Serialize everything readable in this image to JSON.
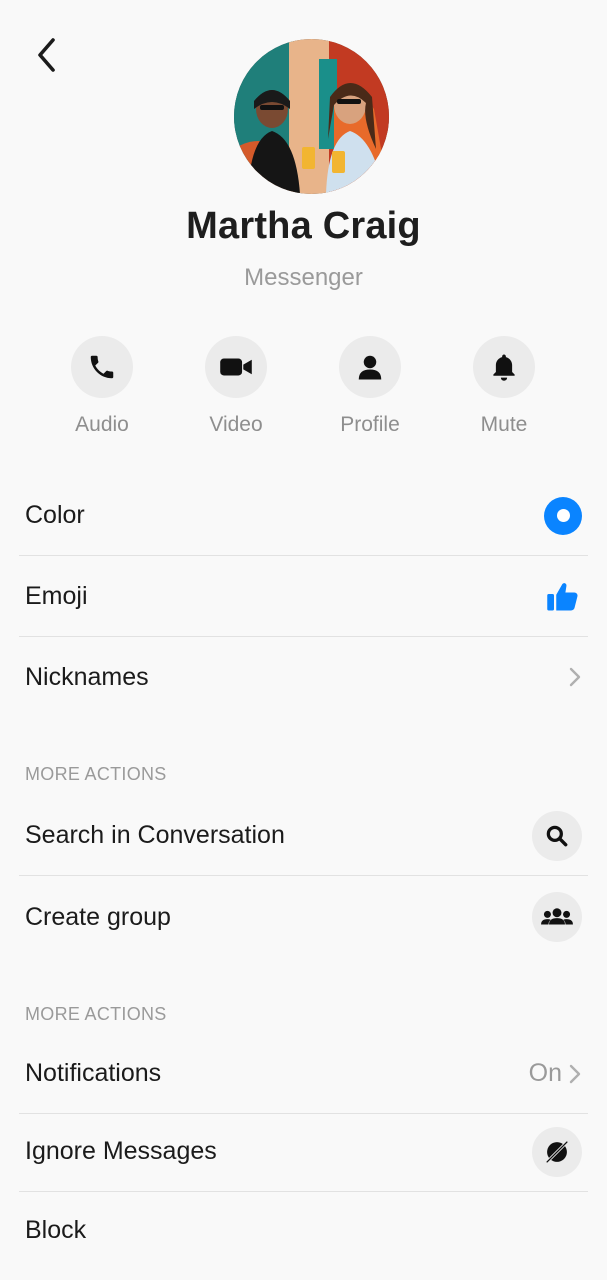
{
  "contact": {
    "name": "Martha Craig",
    "subtitle": "Messenger"
  },
  "quick_actions": [
    {
      "label": "Audio",
      "icon": "phone-icon"
    },
    {
      "label": "Video",
      "icon": "video-camera-icon"
    },
    {
      "label": "Profile",
      "icon": "person-icon"
    },
    {
      "label": "Mute",
      "icon": "bell-icon"
    }
  ],
  "customize": {
    "color_label": "Color",
    "emoji_label": "Emoji",
    "nicknames_label": "Nicknames"
  },
  "section_1": {
    "header": "MORE ACTIONS",
    "search_label": "Search in Conversation",
    "create_group_label": "Create group"
  },
  "section_2": {
    "header": "MORE ACTIONS",
    "notifications_label": "Notifications",
    "notifications_value": "On",
    "ignore_label": "Ignore Messages",
    "block_label": "Block"
  },
  "colors": {
    "accent": "#0a84ff",
    "background": "#f9f9f9",
    "circle_bg": "#ebebeb"
  }
}
